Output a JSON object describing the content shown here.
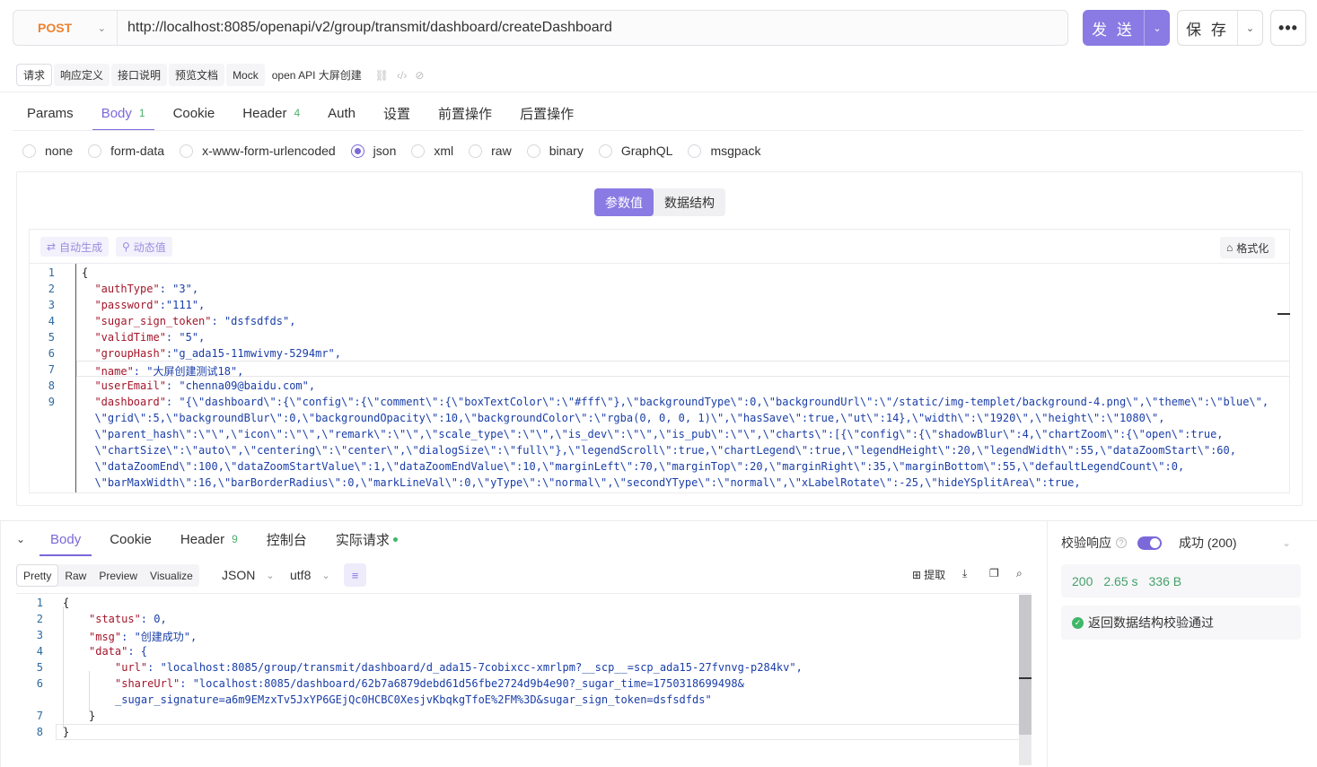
{
  "request": {
    "method": "POST",
    "url": "http://localhost:8085/openapi/v2/group/transmit/dashboard/createDashboard",
    "send_label": "发 送",
    "save_label": "保 存"
  },
  "doc_tabs": [
    "请求",
    "响应定义",
    "接口说明",
    "预览文档",
    "Mock"
  ],
  "doc_title": "open API 大屏创建",
  "req_tabs": [
    {
      "label": "Params",
      "badge": ""
    },
    {
      "label": "Body",
      "badge": "1"
    },
    {
      "label": "Cookie",
      "badge": ""
    },
    {
      "label": "Header",
      "badge": "4"
    },
    {
      "label": "Auth",
      "badge": ""
    },
    {
      "label": "设置",
      "badge": ""
    },
    {
      "label": "前置操作",
      "badge": ""
    },
    {
      "label": "后置操作",
      "badge": ""
    }
  ],
  "body_types": [
    "none",
    "form-data",
    "x-www-form-urlencoded",
    "json",
    "xml",
    "raw",
    "binary",
    "GraphQL",
    "msgpack"
  ],
  "body_type_selected": "json",
  "editor": {
    "seg_params": "参数值",
    "seg_schema": "数据结构",
    "auto_gen": "自动生成",
    "dynamic": "动态值",
    "format": "格式化"
  },
  "request_body_lines": [
    {
      "n": "1",
      "k": "",
      "v": "{"
    },
    {
      "n": "2",
      "k": "  \"authType\"",
      "v": ": \"3\","
    },
    {
      "n": "3",
      "k": "  \"password\"",
      "v": ":\"111\","
    },
    {
      "n": "4",
      "k": "  \"sugar_sign_token\"",
      "v": ": \"dsfsdfds\","
    },
    {
      "n": "5",
      "k": "  \"validTime\"",
      "v": ": \"5\","
    },
    {
      "n": "6",
      "k": "  \"groupHash\"",
      "v": ":\"g_ada15-11mwivmy-5294mr\","
    },
    {
      "n": "7",
      "k": "  \"name\"",
      "v": ": \"大屏创建测试18\","
    },
    {
      "n": "8",
      "k": "  \"userEmail\"",
      "v": ": \"chenna09@baidu.com\","
    },
    {
      "n": "9",
      "k": "  \"dashboard\"",
      "v": ": \"{\\\"dashboard\\\":{\\\"config\\\":{\\\"comment\\\":{\\\"boxTextColor\\\":\\\"#fff\\\"},\\\"backgroundType\\\":0,\\\"backgroundUrl\\\":\\\"/static/img-templet/background-4.png\\\",\\\"theme\\\":\\\"blue\\\","
    },
    {
      "n": "",
      "k": "",
      "v": "  \\\"grid\\\":5,\\\"backgroundBlur\\\":0,\\\"backgroundOpacity\\\":10,\\\"backgroundColor\\\":\\\"rgba(0, 0, 0, 1)\\\",\\\"hasSave\\\":true,\\\"ut\\\":14},\\\"width\\\":\\\"1920\\\",\\\"height\\\":\\\"1080\\\","
    },
    {
      "n": "",
      "k": "",
      "v": "  \\\"parent_hash\\\":\\\"\\\",\\\"icon\\\":\\\"\\\",\\\"remark\\\":\\\"\\\",\\\"scale_type\\\":\\\"\\\",\\\"is_dev\\\":\\\"\\\",\\\"is_pub\\\":\\\"\\\",\\\"charts\\\":[{\\\"config\\\":{\\\"shadowBlur\\\":4,\\\"chartZoom\\\":{\\\"open\\\":true,"
    },
    {
      "n": "",
      "k": "",
      "v": "  \\\"chartSize\\\":\\\"auto\\\",\\\"centering\\\":\\\"center\\\",\\\"dialogSize\\\":\\\"full\\\"},\\\"legendScroll\\\":true,\\\"chartLegend\\\":true,\\\"legendHeight\\\":20,\\\"legendWidth\\\":55,\\\"dataZoomStart\\\":60,"
    },
    {
      "n": "",
      "k": "",
      "v": "  \\\"dataZoomEnd\\\":100,\\\"dataZoomStartValue\\\":1,\\\"dataZoomEndValue\\\":10,\\\"marginLeft\\\":70,\\\"marginTop\\\":20,\\\"marginRight\\\":35,\\\"marginBottom\\\":55,\\\"defaultLegendCount\\\":0,"
    },
    {
      "n": "",
      "k": "",
      "v": "  \\\"barMaxWidth\\\":16,\\\"barBorderRadius\\\":0,\\\"markLineVal\\\":0,\\\"yType\\\":\\\"normal\\\",\\\"secondYType\\\":\\\"normal\\\",\\\"xLabelRotate\\\":-25,\\\"hideYSplitArea\\\":true,"
    }
  ],
  "response": {
    "tabs": [
      {
        "label": "Body",
        "badge": ""
      },
      {
        "label": "Cookie",
        "badge": ""
      },
      {
        "label": "Header",
        "badge": "9"
      },
      {
        "label": "控制台",
        "badge": ""
      },
      {
        "label": "实际请求",
        "badge": ""
      }
    ],
    "views": [
      "Pretty",
      "Raw",
      "Preview",
      "Visualize"
    ],
    "format": "JSON",
    "encoding": "utf8",
    "extract": "提取",
    "lines": [
      {
        "n": "1",
        "indent": 0,
        "k": "",
        "v": "{"
      },
      {
        "n": "2",
        "indent": 1,
        "k": "\"status\"",
        "v": ": 0,"
      },
      {
        "n": "3",
        "indent": 1,
        "k": "\"msg\"",
        "v": ": \"创建成功\","
      },
      {
        "n": "4",
        "indent": 1,
        "k": "\"data\"",
        "v": ": {"
      },
      {
        "n": "5",
        "indent": 2,
        "k": "\"url\"",
        "v": ": \"localhost:8085/group/transmit/dashboard/d_ada15-7cobixcc-xmrlpm?__scp__=scp_ada15-27fvnvg-p284kv\","
      },
      {
        "n": "6",
        "indent": 2,
        "k": "\"shareUrl\"",
        "v": ": \"localhost:8085/dashboard/62b7a6879debd61d56fbe2724d9b4e90?_sugar_time=1750318699498&"
      },
      {
        "n": "",
        "indent": 2,
        "k": "",
        "v": "_sugar_signature=a6m9EMzxTv5JxYP6GEjQc0HCBC0XesjvKbqkgTfoE%2FM%3D&sugar_sign_token=dsfsdfds\""
      },
      {
        "n": "7",
        "indent": 1,
        "k": "",
        "v": "}"
      },
      {
        "n": "8",
        "indent": 0,
        "k": "",
        "v": "}"
      }
    ],
    "verify_label": "校验响应",
    "verify_status": "成功 (200)",
    "status_code": "200",
    "time": "2.65 s",
    "size": "336 B",
    "schema_ok": "返回数据结构校验通过"
  },
  "colors": {
    "accent": "#7b68d9",
    "send": "#8a7ae3",
    "method": "#f0822f",
    "success": "#3fb768"
  }
}
